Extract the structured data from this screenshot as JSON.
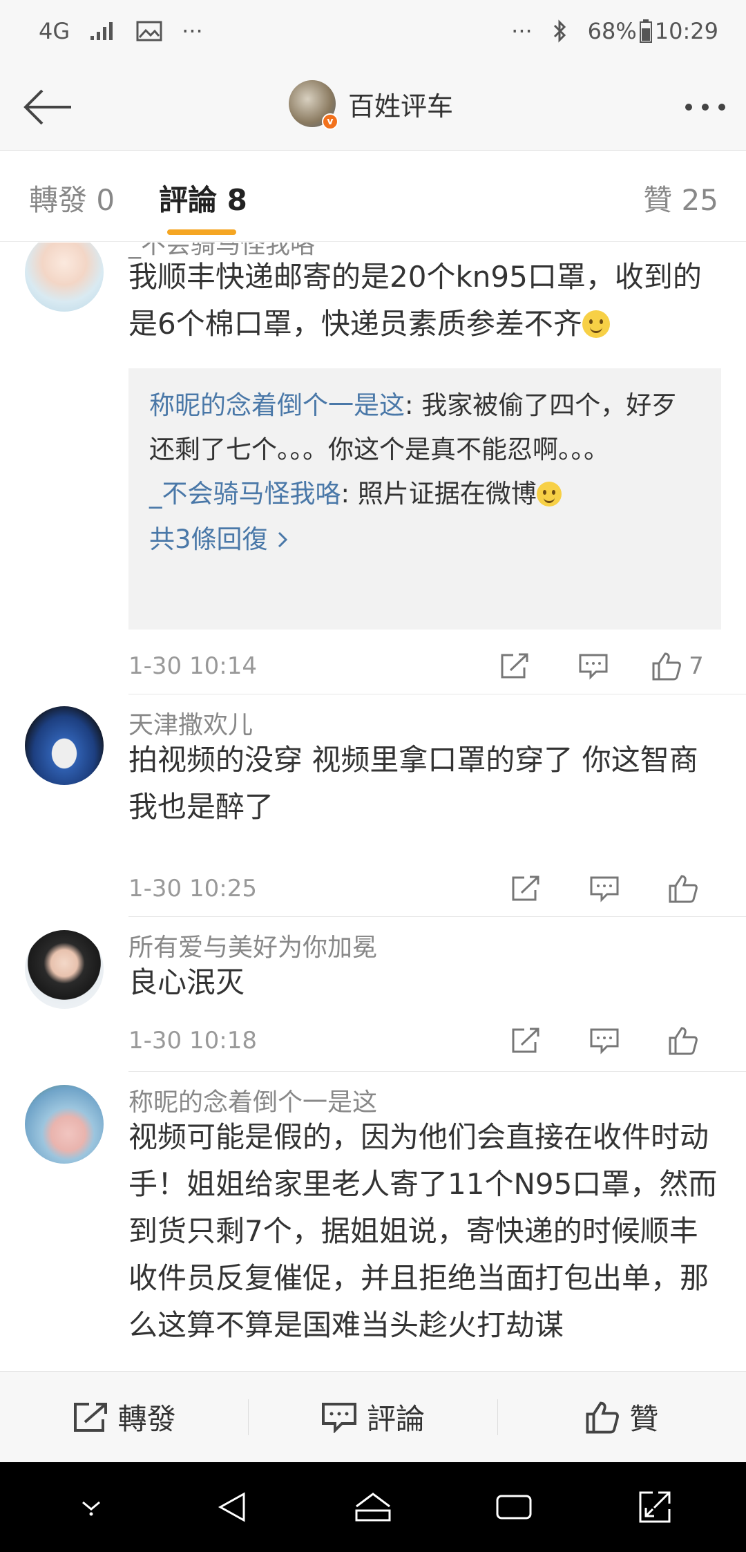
{
  "status_bar": {
    "network": "4G",
    "more": "···",
    "right_more": "···",
    "battery": "68%",
    "time": "10:29"
  },
  "header": {
    "account_name": "百姓评车",
    "verified_badge": "v"
  },
  "tabs": {
    "repost": "轉發 0",
    "comments": "評論 8",
    "likes": "贊 25"
  },
  "comments": [
    {
      "username": "_不会骑马怪我咯",
      "text": "我顺丰快递邮寄的是20个kn95口罩，收到的是6个棉口罩，快递员素质参差不齐",
      "replies": [
        {
          "name": "称昵的念着倒个一是这",
          "text": ": 我家被偷了四个，好歹还剩了七个。。。你这个是真不能忍啊。。。"
        },
        {
          "name": "_不会骑马怪我咯",
          "text": ": 照片证据在微博"
        }
      ],
      "replies_total": "共3條回復",
      "time": "1-30 10:14",
      "likes": "7"
    },
    {
      "username": "天津撒欢儿",
      "text": "拍视频的没穿 视频里拿口罩的穿了 你这智商我也是醉了",
      "time": "1-30 10:25",
      "likes": ""
    },
    {
      "username": "所有爱与美好为你加冕",
      "text": "良心泯灭",
      "time": "1-30 10:18",
      "likes": ""
    },
    {
      "username": "称昵的念着倒个一是这",
      "text": "视频可能是假的，因为他们会直接在收件时动手！姐姐给家里老人寄了11个N95口罩，然而到货只剩7个，据姐姐说，寄快递的时候顺丰收件员反复催促，并且拒绝当面打包出单，那么这算不算是国难当头趁火打劫谋",
      "time": "",
      "likes": ""
    }
  ],
  "bottom_bar": {
    "repost": "轉發",
    "comment": "評論",
    "like": "贊"
  },
  "colors": {
    "accent": "#f5a623",
    "link": "#4a78a8",
    "verified": "#f2711c"
  }
}
